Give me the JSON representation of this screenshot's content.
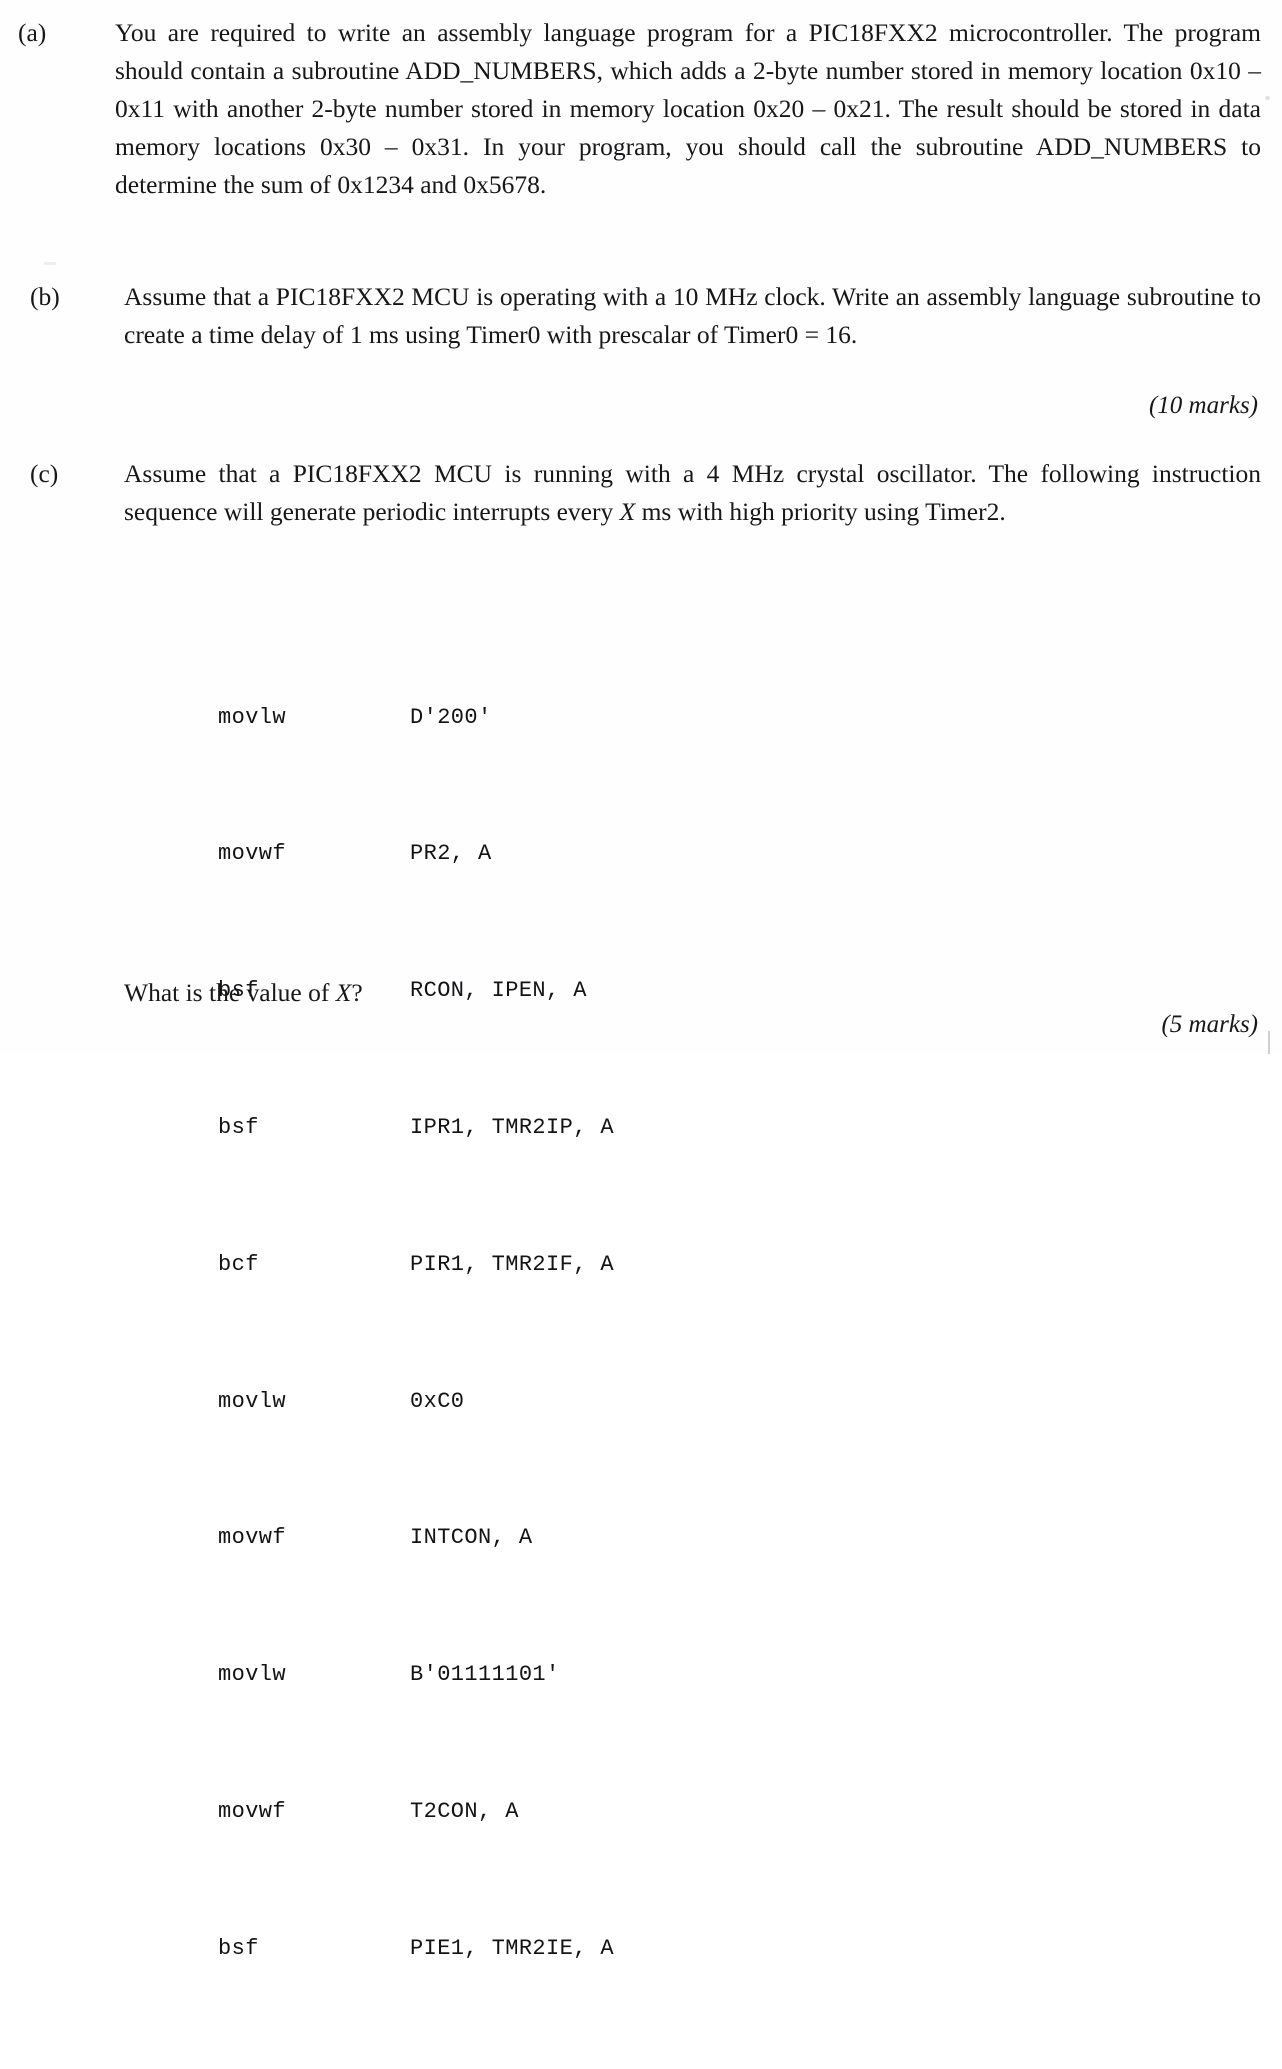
{
  "document": {
    "type": "exam-question-sheet",
    "questions": [
      {
        "label": "(a)",
        "text": "You are required to write an assembly language program for a PIC18FXX2 microcontroller. The program should contain a subroutine ADD_NUMBERS, which adds a 2-byte number stored in memory location 0x10 – 0x11 with another 2-byte number stored in memory location 0x20 – 0x21. The result should be stored in data memory locations 0x30 – 0x31. In your program, you should call the subroutine ADD_NUMBERS to determine the sum of 0x1234 and 0x5678."
      },
      {
        "label": "(b)",
        "text": "Assume that a PIC18FXX2 MCU is operating with a 10 MHz clock. Write an assembly language subroutine to create a time delay of 1 ms using Timer0 with prescalar of Timer0 = 16.",
        "marks": "(10 marks)"
      },
      {
        "label": "(c)",
        "text_before_var": "Assume that a PIC18FXX2 MCU is running with a 4 MHz crystal oscillator. The following instruction sequence will generate periodic interrupts every ",
        "variable": "X",
        "text_after_var": " ms with high priority using Timer2.",
        "marks": "(5 marks)"
      }
    ],
    "code_listing": [
      {
        "mnemonic": "movlw",
        "operand": "D'200'"
      },
      {
        "mnemonic": "movwf",
        "operand": "PR2, A"
      },
      {
        "mnemonic": "bsf",
        "operand": "RCON, IPEN, A"
      },
      {
        "mnemonic": "bsf",
        "operand": "IPR1, TMR2IP, A"
      },
      {
        "mnemonic": "bcf",
        "operand": "PIR1, TMR2IF, A"
      },
      {
        "mnemonic": "movlw",
        "operand": "0xC0"
      },
      {
        "mnemonic": "movwf",
        "operand": "INTCON, A"
      },
      {
        "mnemonic": "movlw",
        "operand": "B'01111101'"
      },
      {
        "mnemonic": "movwf",
        "operand": "T2CON, A"
      },
      {
        "mnemonic": "bsf",
        "operand": "PIE1, TMR2IE, A"
      }
    ],
    "closing": {
      "text_before_var": "What is the value of ",
      "variable": "X",
      "text_after_var": "?"
    },
    "colors": {
      "page_background": "#fefefe",
      "body_text": "#17171a",
      "code_text": "#131316"
    }
  }
}
